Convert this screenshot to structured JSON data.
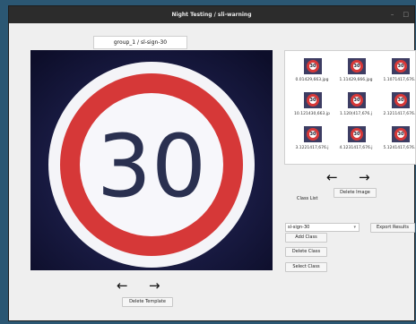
{
  "window": {
    "title": "Night Testing / sli-warning"
  },
  "template": {
    "label": "group_1 / sl-sign-30",
    "sign_value": "30",
    "delete_label": "Delete Template"
  },
  "gallery": {
    "items": [
      {
        "caption": "0.01429,663.jpg",
        "value": "30"
      },
      {
        "caption": "1.11429,666.jpg",
        "value": "30"
      },
      {
        "caption": "1.1071417,676.j",
        "value": "30"
      },
      {
        "caption": "10.121430,663.jp",
        "value": "30"
      },
      {
        "caption": "1.120(417,676.j",
        "value": "30"
      },
      {
        "caption": "2.1211417,676.j",
        "value": "30"
      },
      {
        "caption": "3.1221417,676.j",
        "value": "30"
      },
      {
        "caption": "4.1231417,676.j",
        "value": "30"
      },
      {
        "caption": "5.1241417,676.j",
        "value": "30"
      }
    ],
    "delete_image_label": "Delete Image"
  },
  "classes": {
    "list_label": "Class List",
    "selected": "sl-sign-30",
    "add_label": "Add Class",
    "delete_label": "Delete Class",
    "select_label": "Select Class",
    "export_label": "Export Results"
  },
  "icons": {
    "prev": "arrow-left-icon",
    "next": "arrow-right-icon",
    "dropdown": "chevron-down-icon"
  },
  "colors": {
    "titlebar": "#2c2c2c",
    "desktop": "#2b5773",
    "window_bg": "#efefef",
    "sign_red": "#d63838"
  }
}
